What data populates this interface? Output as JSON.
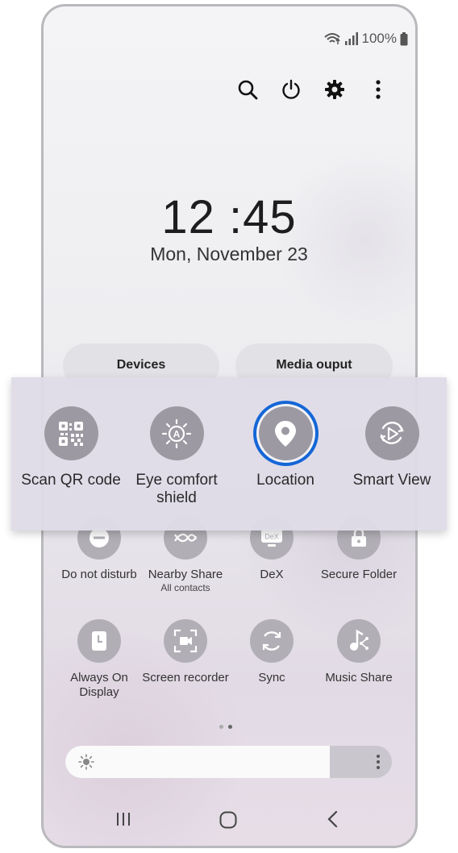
{
  "status": {
    "battery": "100%"
  },
  "top_actions": [
    "search-icon",
    "power-icon",
    "settings-icon",
    "more-icon"
  ],
  "clock": {
    "time": "12 :45",
    "date": "Mon, November 23"
  },
  "pills": {
    "devices": "Devices",
    "media": "Media ouput"
  },
  "panel_tiles": [
    {
      "label": "Scan QR code",
      "icon": "qr-code-icon"
    },
    {
      "label": "Eye comfort shield",
      "icon": "eye-comfort-icon"
    },
    {
      "label": "Location",
      "icon": "location-icon",
      "selected": true
    },
    {
      "label": "Smart View",
      "icon": "smart-view-icon"
    }
  ],
  "grid": {
    "row1": [
      {
        "label": "Do not disturb",
        "icon": "do-not-disturb-icon"
      },
      {
        "label": "Nearby Share",
        "sub": "All contacts",
        "icon": "nearby-share-icon"
      },
      {
        "label": "DeX",
        "icon": "dex-icon",
        "glyph": "DeX"
      },
      {
        "label": "Secure Folder",
        "icon": "secure-folder-icon"
      }
    ],
    "row2": [
      {
        "label": "Always On Display",
        "icon": "always-on-display-icon"
      },
      {
        "label": "Screen recorder",
        "icon": "screen-recorder-icon"
      },
      {
        "label": "Sync",
        "icon": "sync-icon"
      },
      {
        "label": "Music Share",
        "icon": "music-share-icon"
      }
    ]
  },
  "brightness": {
    "level": 0.81
  },
  "page_indicator": {
    "pages": 2,
    "current": 2
  },
  "colors": {
    "accent": "#1566d6",
    "tile": "#9c99a2"
  }
}
